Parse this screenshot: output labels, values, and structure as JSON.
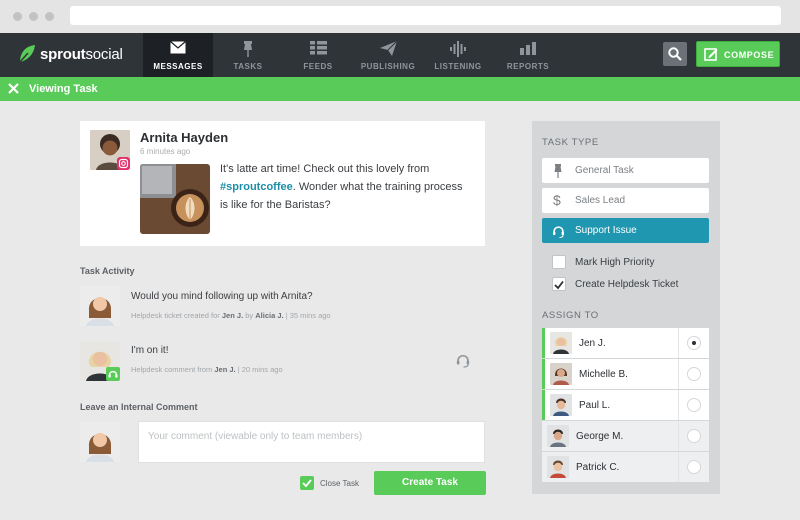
{
  "nav": {
    "logo_bold": "sprout",
    "logo_light": "social",
    "items": [
      {
        "label": "MESSAGES",
        "icon": "envelope-icon",
        "active": true
      },
      {
        "label": "TASKS",
        "icon": "pin-icon"
      },
      {
        "label": "FEEDS",
        "icon": "list-icon"
      },
      {
        "label": "PUBLISHING",
        "icon": "paper-plane-icon"
      },
      {
        "label": "LISTENING",
        "icon": "waveform-icon"
      },
      {
        "label": "REPORTS",
        "icon": "bar-chart-icon"
      }
    ],
    "compose_label": "COMPOSE"
  },
  "taskbar": {
    "title": "Viewing Task"
  },
  "message": {
    "author": "Arnita Hayden",
    "time": "6 minutes ago",
    "text_before": "It's latte art time! Check out this lovely from ",
    "hashtag": "#sproutcoffee",
    "text_after": ". Wonder what the training process is like for the Baristas?"
  },
  "activity": {
    "title": "Task Activity",
    "items": [
      {
        "text": "Would you mind following up with Arnita?",
        "meta_prefix": "Helpdesk ticket created for ",
        "meta_user": "Jen J.",
        "meta_mid": " by ",
        "meta_by": "Alicia J.",
        "meta_time": " | 35 mins ago"
      },
      {
        "text": "I'm on it!",
        "meta_prefix": "Helpdesk comment from ",
        "meta_user": "Jen J.",
        "meta_time": " | 20 mins ago"
      }
    ]
  },
  "comment": {
    "title": "Leave an Internal Comment",
    "placeholder": "Your comment (viewable only to team members)",
    "close_label": "Close Task",
    "close_checked": true,
    "create_label": "Create Task"
  },
  "panel": {
    "task_type_title": "TASK TYPE",
    "types": [
      {
        "label": "General Task",
        "icon": "pin-icon"
      },
      {
        "label": "Sales Lead",
        "icon": "dollar-icon"
      },
      {
        "label": "Support Issue",
        "icon": "headset-icon",
        "active": true
      }
    ],
    "checks": [
      {
        "label": "Mark High Priority",
        "checked": false
      },
      {
        "label": "Create Helpdesk Ticket",
        "checked": true
      }
    ],
    "assign_title": "ASSIGN TO",
    "assignees": [
      {
        "name": "Jen J.",
        "selected": true
      },
      {
        "name": "Michelle B."
      },
      {
        "name": "Paul L."
      },
      {
        "name": "George M."
      },
      {
        "name": "Patrick C."
      }
    ]
  },
  "colors": {
    "brand_green": "#59cb59",
    "nav_dark": "#2f3439",
    "accent_teal": "#1f97b1"
  }
}
